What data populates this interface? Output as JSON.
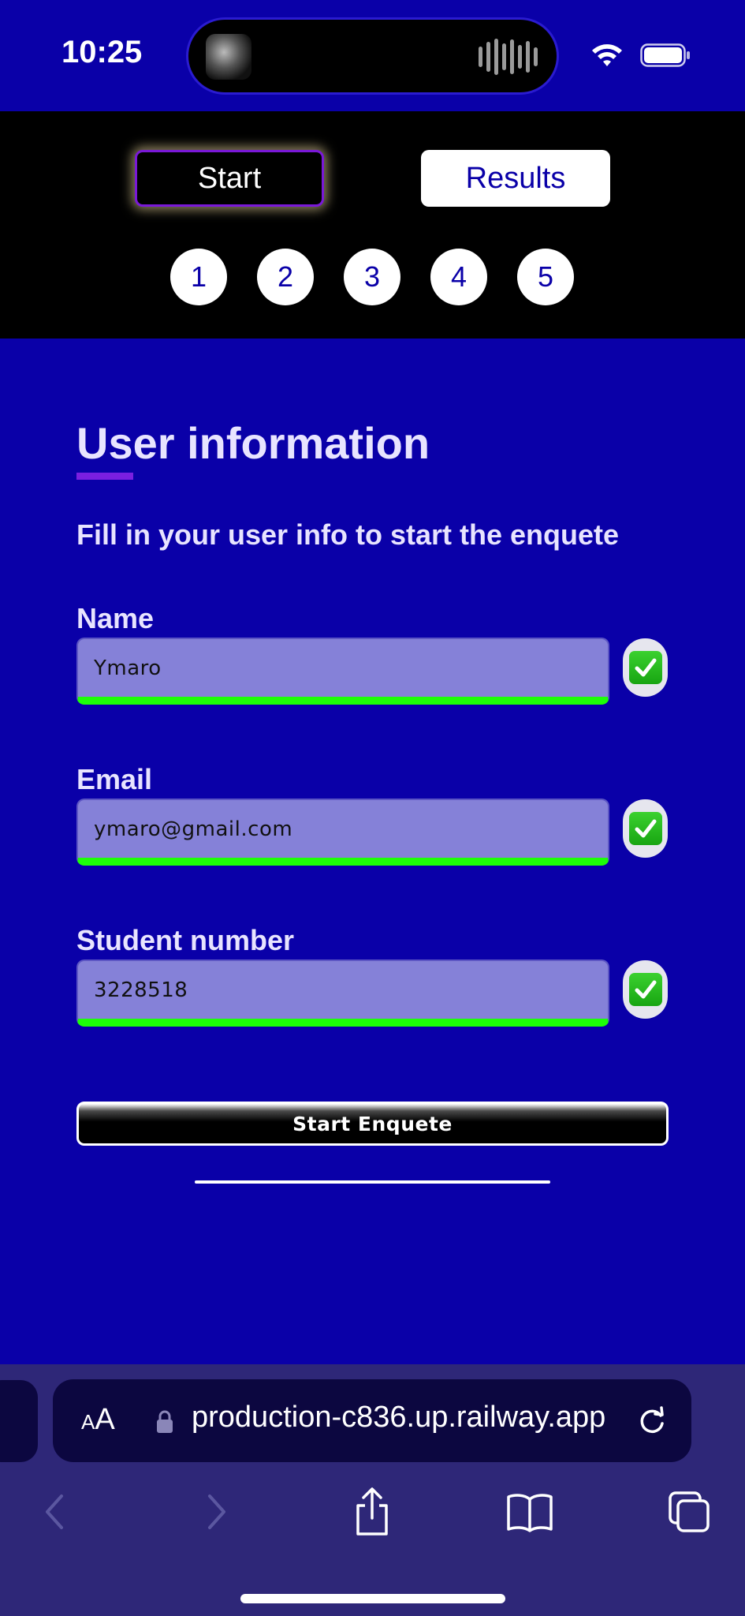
{
  "status_bar": {
    "time": "10:25",
    "icons": [
      "wifi-icon",
      "battery-icon"
    ]
  },
  "nav": {
    "start_label": "Start",
    "results_label": "Results",
    "steps": [
      "1",
      "2",
      "3",
      "4",
      "5"
    ]
  },
  "form": {
    "title": "User information",
    "subtitle": "Fill in your user info to start the enquete",
    "fields": [
      {
        "label": "Name",
        "value": "Ymaro",
        "valid": true
      },
      {
        "label": "Email",
        "value": "ymaro@gmail.com",
        "valid": true
      },
      {
        "label": "Student number",
        "value": "3228518",
        "valid": true
      }
    ],
    "submit_label": "Start Enquete"
  },
  "browser": {
    "aa_small": "A",
    "aa_big": "A",
    "url": "production-c836.up.railway.app",
    "toolbar_icons": [
      "back-icon",
      "forward-icon",
      "share-icon",
      "bookmarks-icon",
      "tabs-icon"
    ]
  },
  "colors": {
    "background": "#0a00a8",
    "nav_background": "#000000",
    "accent_purple": "#7a1fe0",
    "input_fill": "#8581d8",
    "valid_green": "#1dff08",
    "browser_chrome": "#2e2778"
  }
}
